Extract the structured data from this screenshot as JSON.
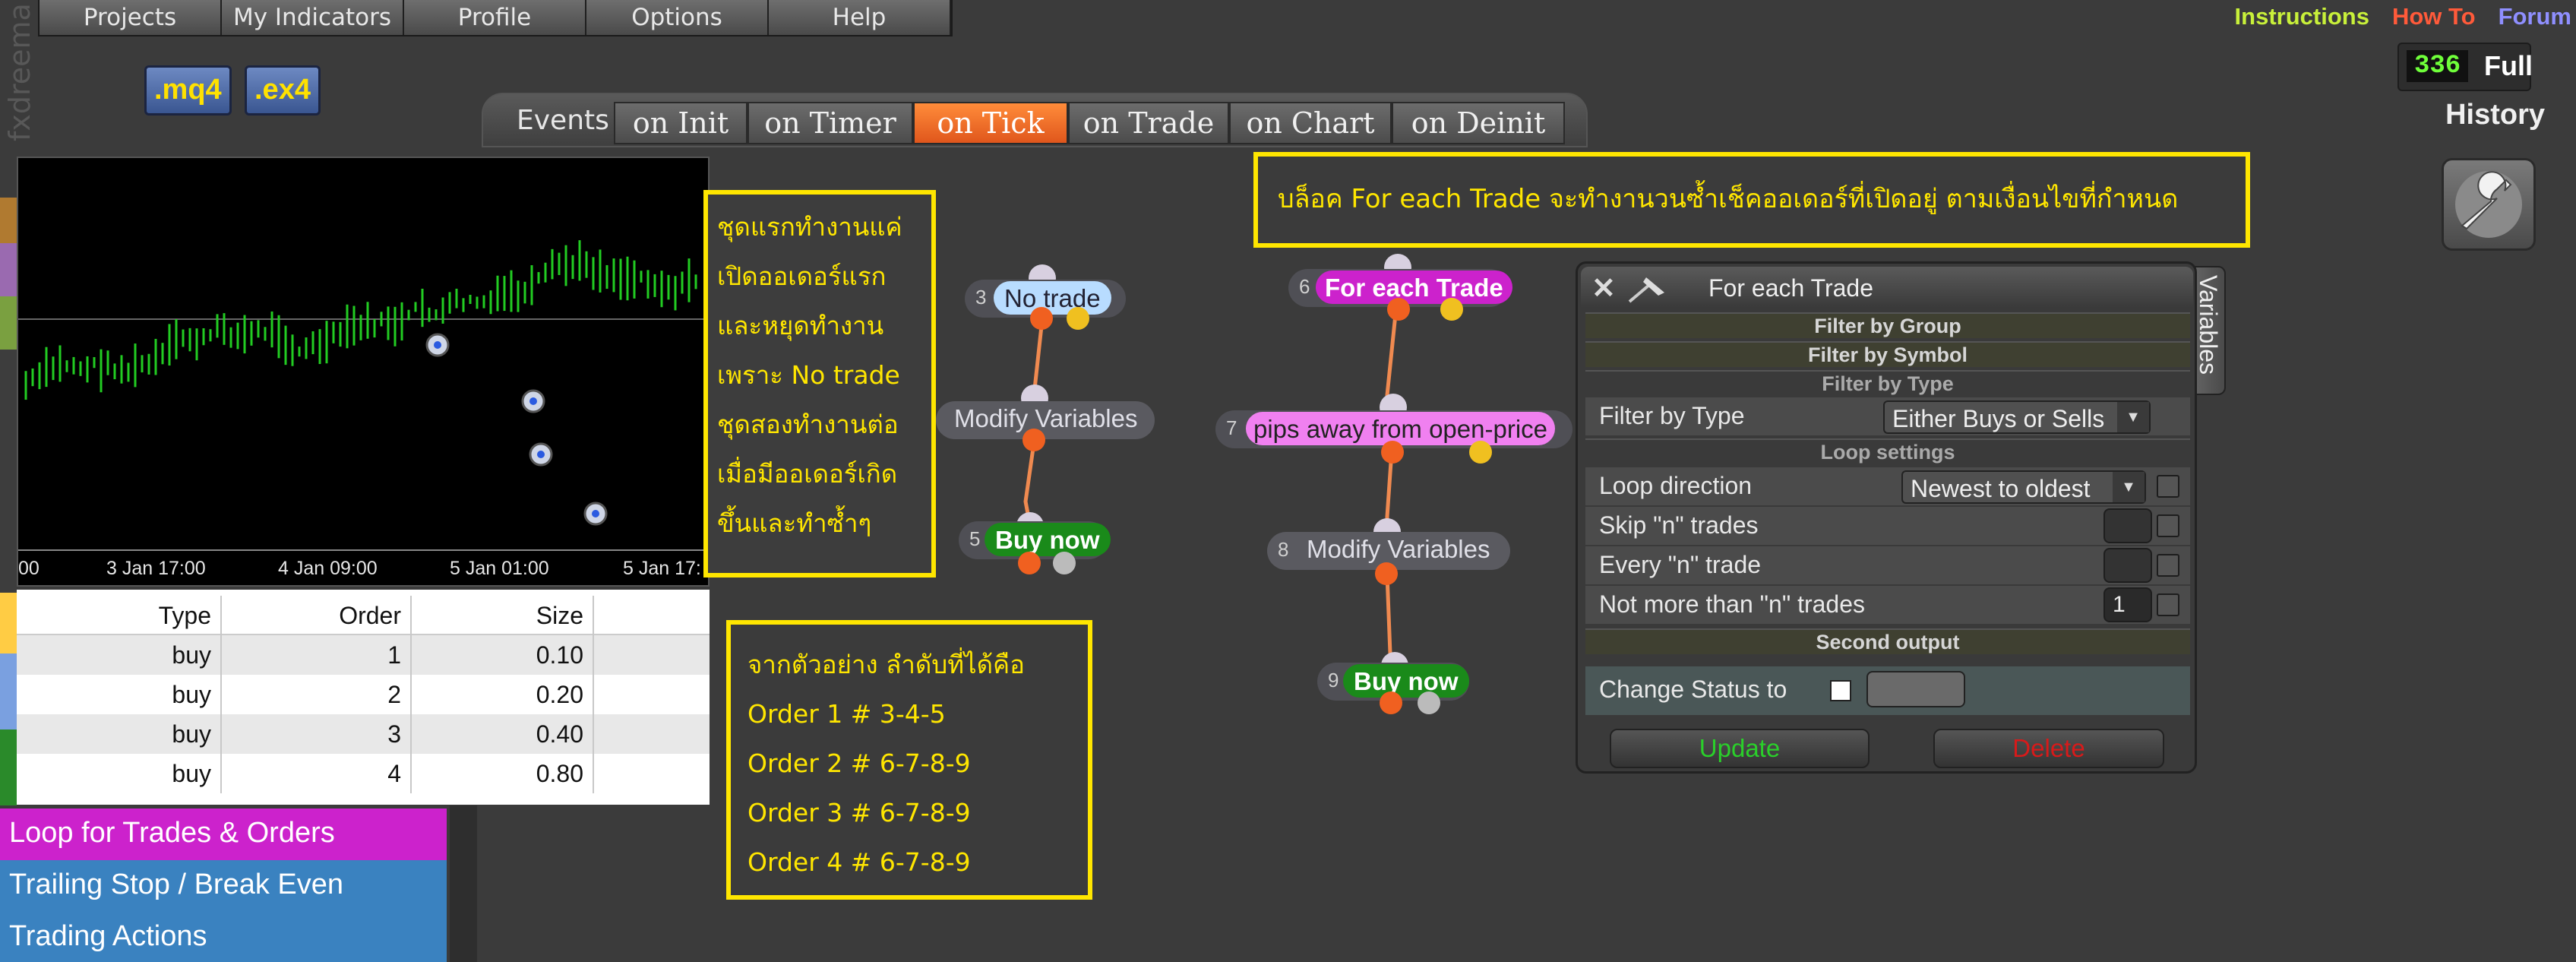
{
  "menu": [
    "Projects",
    "My Indicators",
    "Profile",
    "Options",
    "Help"
  ],
  "top_links": [
    {
      "label": "Instructions",
      "color": "#c8f03a"
    },
    {
      "label": "How To",
      "color": "#ff5a3a"
    },
    {
      "label": "Forum",
      "color": "#8f8fff"
    }
  ],
  "counter": {
    "value": "336",
    "label": "Full"
  },
  "history_label": "History",
  "file_buttons": [
    ".mq4",
    ".ex4"
  ],
  "brand_vertical": "fxdreema",
  "events": {
    "label": "Events",
    "tabs": [
      "on Init",
      "on Timer",
      "on Tick",
      "on Trade",
      "on Chart",
      "on Deinit"
    ],
    "active": "on Tick"
  },
  "chart": {
    "x_labels": [
      "3 Jan 17:00",
      "4 Jan 09:00",
      "5 Jan 01:00",
      "5 Jan 17:"
    ],
    "left_label": "00"
  },
  "trade_table": {
    "headers": [
      "Type",
      "Order",
      "Size"
    ],
    "rows": [
      [
        "buy",
        "1",
        "0.10"
      ],
      [
        "buy",
        "2",
        "0.20"
      ],
      [
        "buy",
        "3",
        "0.40"
      ],
      [
        "buy",
        "4",
        "0.80"
      ]
    ]
  },
  "categories": [
    {
      "label": "Loop for Trades & Orders",
      "color": "#cc22cc"
    },
    {
      "label": "Trailing Stop / Break Even",
      "color": "#3a82c0"
    },
    {
      "label": "Trading Actions",
      "color": "#3a82c0"
    }
  ],
  "notes": {
    "left_box": [
      "ชุดแรกทำงานแค่",
      "เปิดออเดอร์แรก",
      "และหยุดทำงาน",
      "เพราะ No trade",
      "ชุดสองทำงานต่อ",
      "เมื่อมีออเดอร์เกิด",
      "ขึ้นและทำซ้ำๆ"
    ],
    "top_box": "บล็อค For each Trade จะทำงานวนซ้ำเช็คออเดอร์ที่เปิดอยู่ ตามเงื่อนไขที่กำหนด",
    "bottom_box": [
      "จากตัวอย่าง ลำดับที่ได้คือ",
      "Order 1 # 3-4-5",
      "Order 2 # 6-7-8-9",
      "Order 3 # 6-7-8-9",
      "Order 4 # 6-7-8-9"
    ]
  },
  "blocks": {
    "b3": {
      "num": "3",
      "label": "No trade"
    },
    "b4": {
      "label": "Modify Variables"
    },
    "b5": {
      "num": "5",
      "label": "Buy now"
    },
    "b6": {
      "num": "6",
      "label": "For each Trade"
    },
    "b7": {
      "num": "7",
      "label": "pips away from open-price"
    },
    "b8": {
      "num": "8",
      "label": "Modify Variables"
    },
    "b9": {
      "num": "9",
      "label": "Buy now"
    }
  },
  "panel": {
    "title": "For each Trade",
    "side_tab": "Variables",
    "sections": [
      "Filter by Group",
      "Filter by Symbol",
      "Filter by Type",
      "Loop settings",
      "Second output"
    ],
    "filter_type_label": "Filter by Type",
    "filter_type_value": "Either Buys or Sells",
    "loop_direction_label": "Loop direction",
    "loop_direction_value": "Newest to oldest",
    "skip_label": "Skip \"n\" trades",
    "every_label": "Every \"n\" trade",
    "notmore_label": "Not more than \"n\" trades",
    "notmore_value": "1",
    "change_status_label": "Change Status to",
    "update": "Update",
    "delete": "Delete"
  }
}
